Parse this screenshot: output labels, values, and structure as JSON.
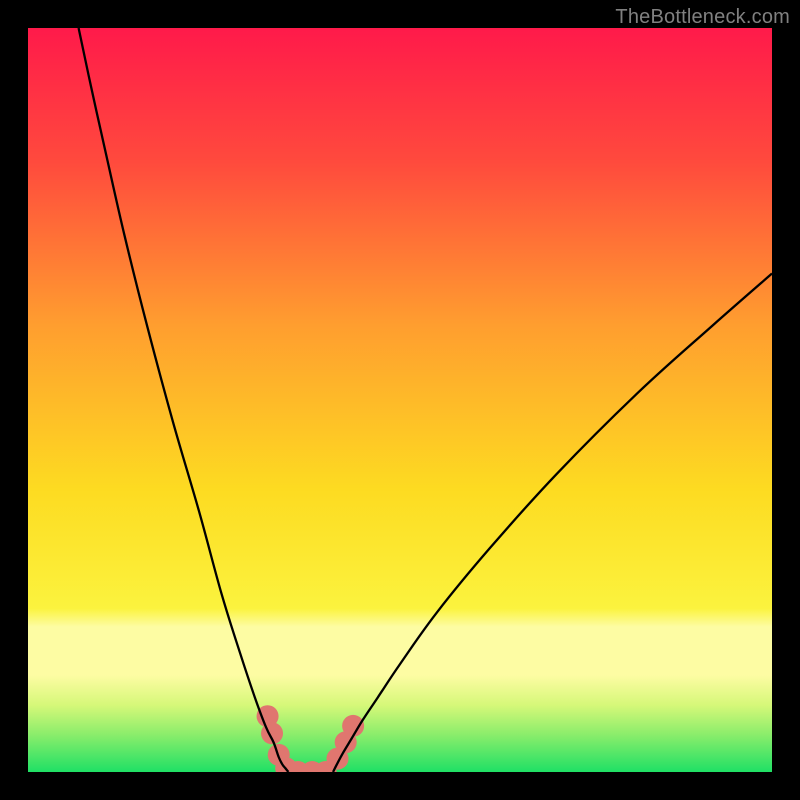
{
  "watermark": "TheBottleneck.com",
  "chart_data": {
    "type": "line",
    "title": "",
    "xlabel": "",
    "ylabel": "",
    "xlim": [
      0,
      100
    ],
    "ylim": [
      0,
      100
    ],
    "legend": false,
    "grid": false,
    "background_gradient": {
      "top_color": "#ff1a4a",
      "mid_color_hi": "#ff8b31",
      "mid_color_mid": "#fbe122",
      "band_color": "#fcfb93",
      "bottom_color": "#1fe065"
    },
    "annotations": [],
    "series": [
      {
        "name": "left-curve",
        "x": [
          6.8,
          8.5,
          10.5,
          13.0,
          16.0,
          19.5,
          23.0,
          26.0,
          28.5,
          30.5,
          32.0,
          33.0,
          33.7,
          34.2,
          34.6,
          35.0
        ],
        "y": [
          100,
          92,
          83,
          72,
          60,
          47,
          35,
          24,
          16,
          10,
          6,
          4,
          2,
          1,
          0.5,
          0
        ]
      },
      {
        "name": "right-curve",
        "x": [
          41.0,
          41.5,
          42.3,
          43.5,
          45.0,
          47.0,
          50.0,
          55.0,
          62.0,
          71.0,
          82.0,
          92.0,
          100.0
        ],
        "y": [
          0,
          1,
          2.5,
          4.5,
          7.0,
          10.0,
          14.5,
          21.5,
          30.0,
          40.0,
          51.0,
          60.0,
          67.0
        ]
      },
      {
        "name": "floor-segment",
        "x": [
          35.0,
          41.0
        ],
        "y": [
          0,
          0
        ]
      }
    ],
    "markers": {
      "name": "highlight-dots",
      "color": "#e0766f",
      "radius": 11,
      "points": [
        {
          "x": 32.2,
          "y": 7.5
        },
        {
          "x": 32.8,
          "y": 5.2
        },
        {
          "x": 33.7,
          "y": 2.3
        },
        {
          "x": 34.7,
          "y": 0.5
        },
        {
          "x": 36.3,
          "y": 0
        },
        {
          "x": 38.2,
          "y": 0
        },
        {
          "x": 40.0,
          "y": 0
        },
        {
          "x": 41.6,
          "y": 1.8
        },
        {
          "x": 42.7,
          "y": 4.0
        },
        {
          "x": 43.7,
          "y": 6.2
        }
      ]
    }
  }
}
